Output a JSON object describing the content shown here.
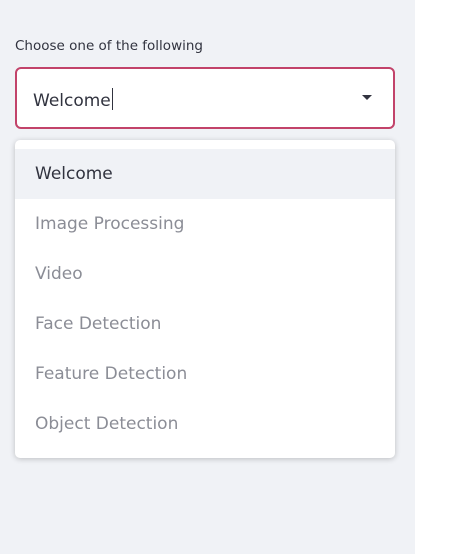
{
  "select": {
    "label": "Choose one of the following",
    "value": "Welcome",
    "options": [
      {
        "label": "Welcome",
        "selected": true
      },
      {
        "label": "Image Processing",
        "selected": false
      },
      {
        "label": "Video",
        "selected": false
      },
      {
        "label": "Face Detection",
        "selected": false
      },
      {
        "label": "Feature Detection",
        "selected": false
      },
      {
        "label": "Object Detection",
        "selected": false
      }
    ]
  },
  "colors": {
    "accent": "#c2436a",
    "sidebar_background": "#f0f2f6",
    "text": "#31333f",
    "muted_text": "#8b8d96"
  },
  "icons": {
    "dropdown": "chevron-down-icon"
  }
}
